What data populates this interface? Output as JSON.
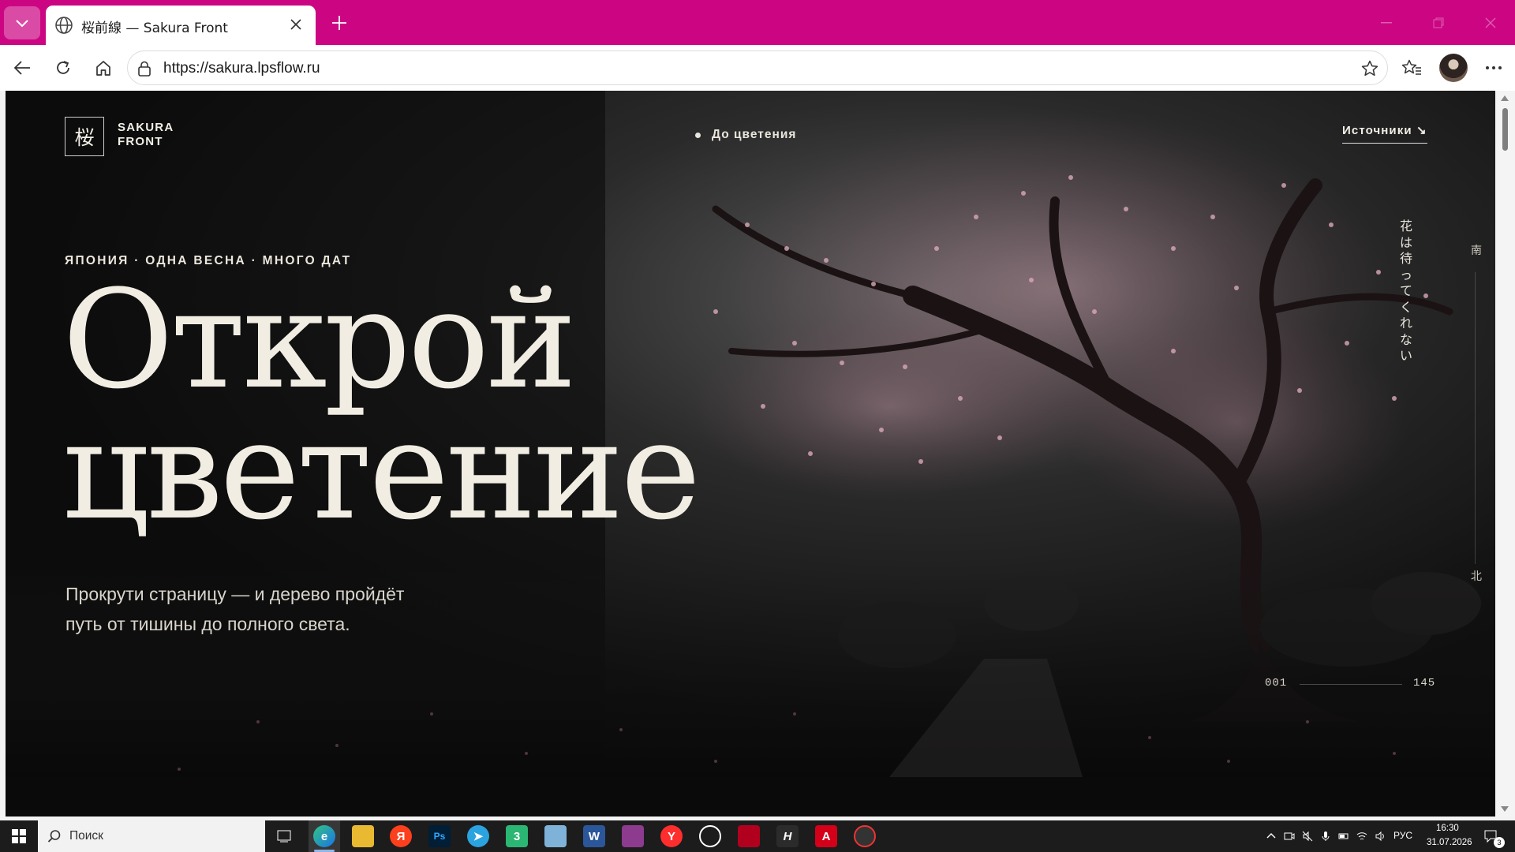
{
  "browser": {
    "tab_title": "桜前線 — Sakura Front",
    "url": "https://sakura.lpsflow.ru",
    "accent_color": "#cc0683"
  },
  "site": {
    "logo_mark": "桜",
    "logo_line1": "SAKURA",
    "logo_line2": "FRONT",
    "nav_label": "До цветения",
    "sources_link": "Источники ↘",
    "eyebrow": "ЯПОНИЯ · ОДНА ВЕСНА · МНОГО ДАТ",
    "headline_line1": "Открой",
    "headline_line2": "цветение",
    "lead_line1": "Прокрути страницу — и дерево пройдёт",
    "lead_line2": "путь от тишины до полного света.",
    "vertical_text": [
      "花",
      "は",
      "待",
      "っ",
      "て",
      "く",
      "れ",
      "な",
      "い"
    ],
    "compass_south": "南",
    "compass_north": "北",
    "counter_start": "001",
    "counter_end": "145",
    "counter_progress": 0
  },
  "taskbar": {
    "search_placeholder": "Поиск",
    "lang": "РУС",
    "time": "16:30",
    "date": "31.07.2026",
    "notifications": "3",
    "apps": [
      "task-view",
      "edge",
      "file-explorer",
      "yandex",
      "photoshop",
      "telegram",
      "app-3",
      "notes",
      "word",
      "winrar",
      "yandex-browser",
      "chatgpt",
      "app-red",
      "h-app",
      "acrobat",
      "screen-recorder"
    ]
  }
}
